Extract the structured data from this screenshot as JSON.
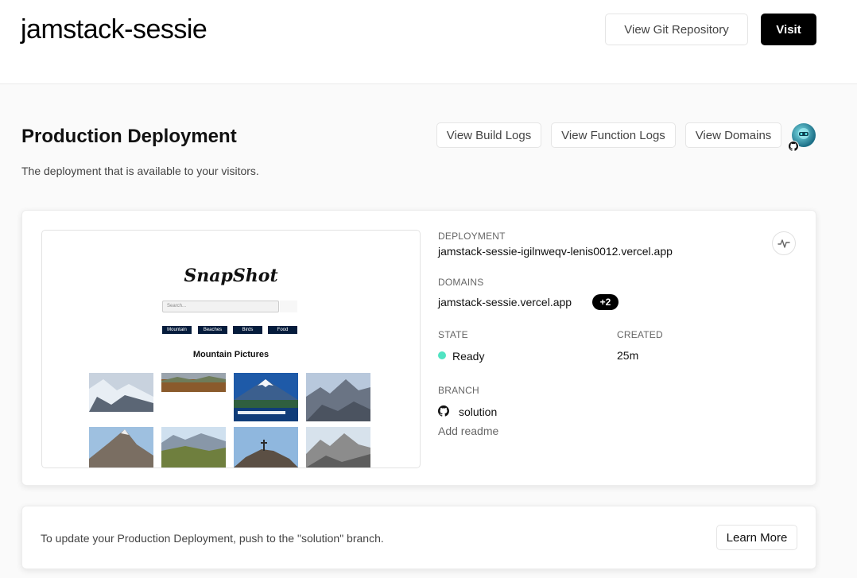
{
  "header": {
    "project_name": "jamstack-sessie",
    "git_button": "View Git Repository",
    "visit_button": "Visit"
  },
  "production": {
    "title": "Production Deployment",
    "subtitle": "The deployment that is available to your visitors.",
    "build_logs_button": "View Build Logs",
    "function_logs_button": "View Function Logs",
    "domains_button": "View Domains"
  },
  "preview": {
    "logo": "SnapShot",
    "search_placeholder": "Search...",
    "categories": [
      "Mountain",
      "Beaches",
      "Birds",
      "Food"
    ],
    "heading": "Mountain Pictures"
  },
  "deployment": {
    "deployment_label": "DEPLOYMENT",
    "deployment_url": "jamstack-sessie-igilnweqv-lenis0012.vercel.app",
    "domains_label": "DOMAINS",
    "domain": "jamstack-sessie.vercel.app",
    "extra_domains": "+2",
    "state_label": "STATE",
    "state": "Ready",
    "created_label": "CREATED",
    "created": "25m",
    "branch_label": "BRANCH",
    "branch": "solution",
    "add_readme": "Add readme",
    "status_color": "#50e3c2"
  },
  "footer_card": {
    "text": "To update your Production Deployment, push to the \"solution\" branch.",
    "learn_more": "Learn More"
  },
  "colors": {
    "accent_black": "#000000",
    "ready_green": "#50e3c2",
    "preview_nav": "#051c3c"
  }
}
